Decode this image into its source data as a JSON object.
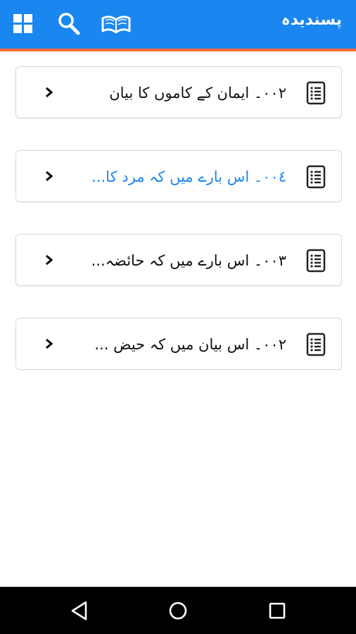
{
  "appbar": {
    "title": "پسندیدہ",
    "icons": [
      "grid-icon",
      "search-icon",
      "open-book-icon"
    ],
    "background": "#1a87f1",
    "accent": "#ff6a3a"
  },
  "favorites": [
    {
      "label": "٠٠٢۔ ایمان کے کاموں کا بیان",
      "active": false
    },
    {
      "label": "٠٠٤۔ اس بارے میں کہ مرد کا...",
      "active": true
    },
    {
      "label": "٠٠٣۔ اس بارے میں کہ حائضہ...",
      "active": false
    },
    {
      "label": "٠٠٢۔ اس بیان میں کہ حیض ...",
      "active": false
    }
  ],
  "item_icons": {
    "leading": "document-list-icon",
    "trailing": "chevron-right-icon"
  },
  "active_color": "#1a87f1",
  "navbar": {
    "buttons": [
      "back-icon",
      "home-icon",
      "recents-icon"
    ]
  }
}
